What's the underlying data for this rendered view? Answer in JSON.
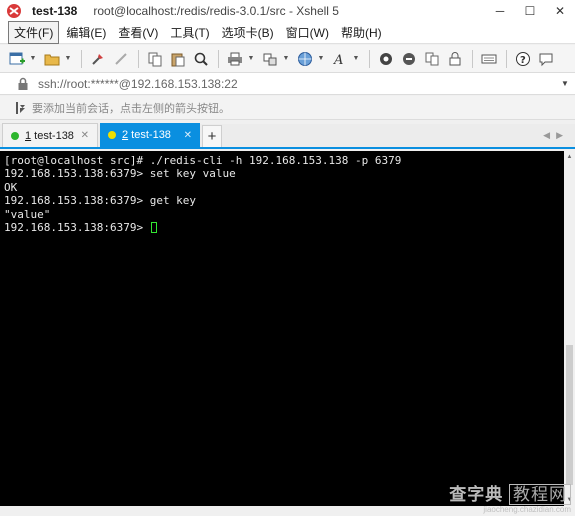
{
  "window": {
    "session_name": "test-138",
    "title": "root@localhost:/redis/redis-3.0.1/src - Xshell 5",
    "minimize": "─",
    "maximize": "☐",
    "close": "✕"
  },
  "menu": [
    {
      "label": "文件(F)",
      "active": true
    },
    {
      "label": "编辑(E)"
    },
    {
      "label": "查看(V)"
    },
    {
      "label": "工具(T)"
    },
    {
      "label": "选项卡(B)"
    },
    {
      "label": "窗口(W)"
    },
    {
      "label": "帮助(H)"
    }
  ],
  "toolbar": {
    "icons": [
      "new-session-icon",
      "open-folder-icon",
      "reconnect-icon",
      "disconnect-icon",
      "copy-icon",
      "paste-icon",
      "find-icon",
      "print-icon",
      "transfer-icon",
      "globe-icon",
      "font-icon",
      "xftp-icon",
      "script-icon",
      "lock-icon",
      "keyboard-icon",
      "help-icon",
      "chat-icon"
    ]
  },
  "address": {
    "text": "ssh://root:******@192.168.153.138:22"
  },
  "hint": {
    "text": "要添加当前会话，点击左侧的箭头按钮。"
  },
  "tabs": [
    {
      "number": "1",
      "name": " test-138",
      "active": false,
      "dot_color": "#2db52d"
    },
    {
      "number": "2",
      "name": " test-138",
      "active": true,
      "dot_color": "#f0e000"
    }
  ],
  "terminal": {
    "lines": [
      "[root@localhost src]# ./redis-cli -h 192.168.153.138 -p 6379",
      "192.168.153.138:6379> set key value",
      "OK",
      "192.168.153.138:6379> get key",
      "\"value\""
    ],
    "prompt": "192.168.153.138:6379> "
  },
  "watermark": {
    "main1": "查字典",
    "main2": "教程网",
    "url": "jiaocheng.chazidian.com"
  }
}
